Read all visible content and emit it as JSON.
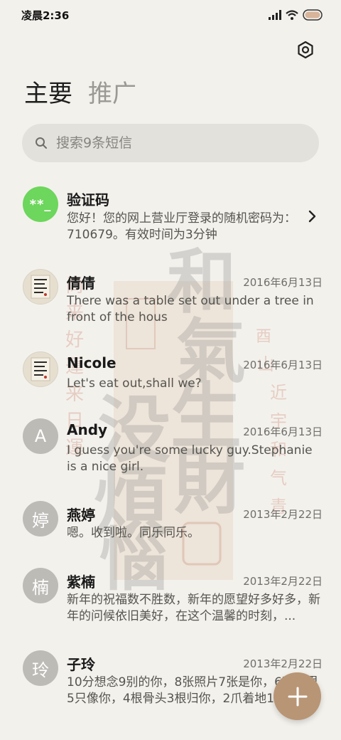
{
  "status_bar": {
    "time": "凌晨2:36"
  },
  "tabs": [
    {
      "label": "主要",
      "active": true
    },
    {
      "label": "推广",
      "active": false
    }
  ],
  "search": {
    "placeholder": "搜索9条短信"
  },
  "messages": [
    {
      "name": "验证码",
      "avatar_text": "**_",
      "avatar_type": "code",
      "date": "",
      "preview": "您好！您的网上营业厅登录的随机密码为：710679。有效时间为3分钟"
    },
    {
      "name": "倩倩",
      "avatar_type": "photo",
      "date": "2016年6月13日",
      "preview": "There was a table set out under a tree in front of the hous"
    },
    {
      "name": "Nicole",
      "avatar_type": "photo",
      "date": "2016年6月13日",
      "preview": "Let's eat out,shall we?"
    },
    {
      "name": "Andy",
      "avatar_text": "A",
      "avatar_type": "letter",
      "date": "2016年6月13日",
      "preview": "I guess you're some lucky guy.Stephanie is a nice girl."
    },
    {
      "name": "燕婷",
      "avatar_text": "婷",
      "avatar_type": "letter",
      "date": "2013年2月22日",
      "preview": "嗯。收到啦。同乐同乐。"
    },
    {
      "name": "紫楠",
      "avatar_text": "楠",
      "avatar_type": "letter",
      "date": "2013年2月22日",
      "preview": "新年的祝福数不胜数，新年的愿望好多好多，新年的问候依旧美好，在这个温馨的时刻，..."
    },
    {
      "name": "子玲",
      "avatar_text": "玲",
      "avatar_type": "letter",
      "date": "2013年2月22日",
      "preview": "10分想念9别的你，8张照片7张是你，6次梦里5只像你，4根骨头3根归你，2爪着地1..."
    }
  ],
  "colors": {
    "background": "#f3f1ec",
    "fab": "#b89575",
    "code_avatar": "#6dd65c",
    "letter_avatar": "#bdbbb6"
  },
  "icons": [
    "settings-icon",
    "search-icon",
    "chevron-right-icon",
    "plus-icon",
    "signal-icon",
    "wifi-icon",
    "battery-icon"
  ]
}
